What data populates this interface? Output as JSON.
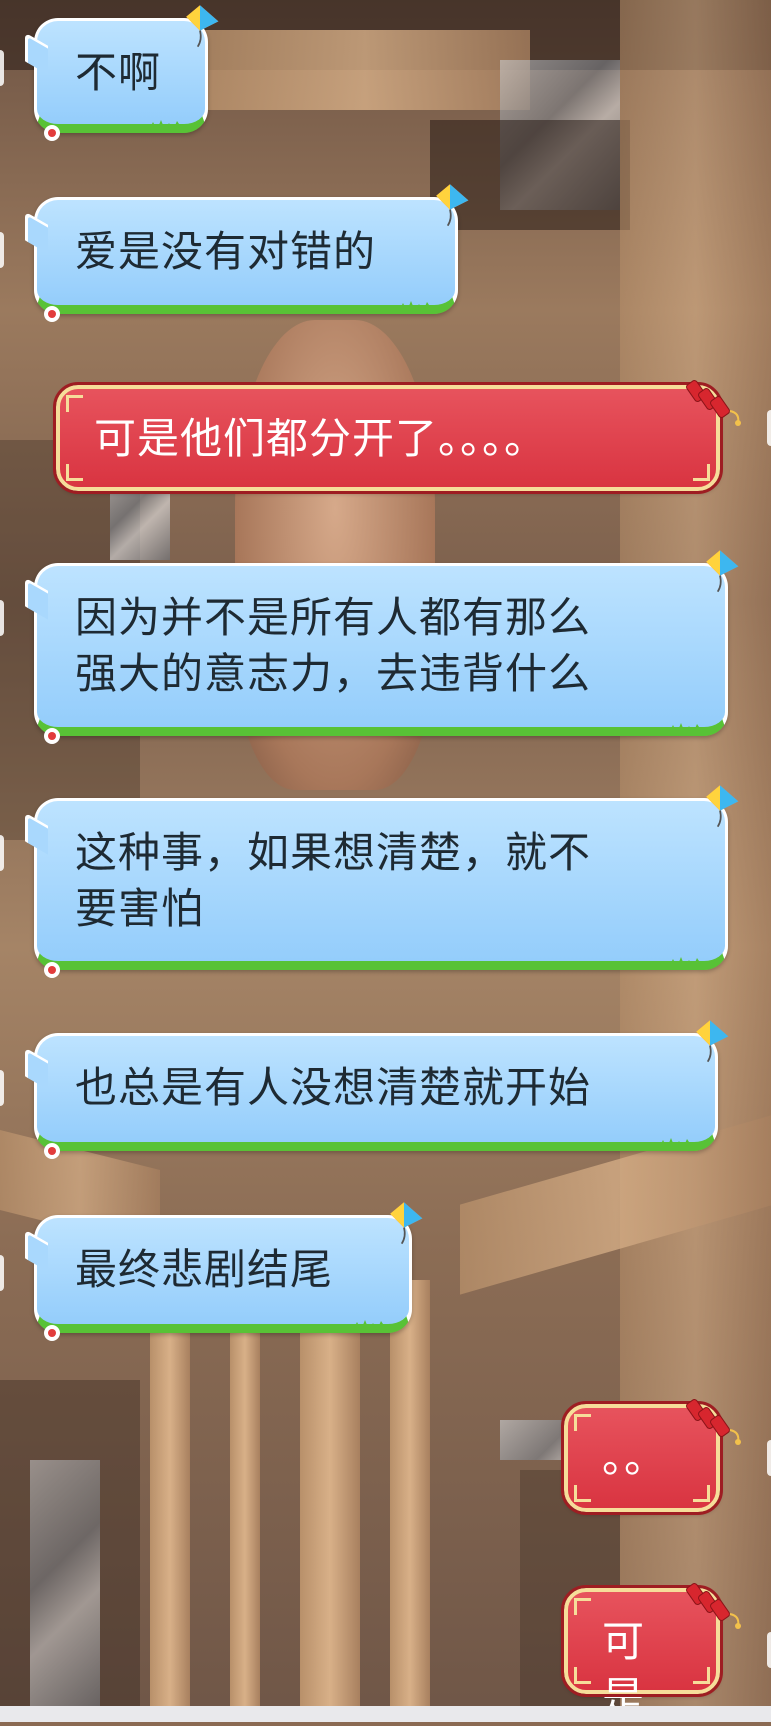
{
  "conversation": {
    "messages": [
      {
        "side": "left",
        "style": "blue",
        "text": "不啊"
      },
      {
        "side": "left",
        "style": "blue",
        "text": "爱是没有对错的"
      },
      {
        "side": "right",
        "style": "red",
        "text": "可是他们都分开了。。。。"
      },
      {
        "side": "left",
        "style": "blue",
        "text": "因为并不是所有人都有那么\n强大的意志力，去违背什么"
      },
      {
        "side": "left",
        "style": "blue",
        "text": "这种事，如果想清楚，就不\n要害怕"
      },
      {
        "side": "left",
        "style": "blue",
        "text": "也总是有人没想清楚就开始"
      },
      {
        "side": "left",
        "style": "blue",
        "text": "最终悲剧结尾"
      },
      {
        "side": "right",
        "style": "red",
        "text": "。。"
      },
      {
        "side": "right",
        "style": "red",
        "text": "可是"
      }
    ]
  },
  "icons": {
    "blue_bubble_decor": "kite-icon",
    "red_bubble_decor": "firecracker-icon"
  },
  "colors": {
    "blue_bubble": "#94cdfb",
    "blue_bubble_border": "#ffffff",
    "grass_strip": "#58c236",
    "red_bubble": "#d93441",
    "red_bubble_border": "#f6dd9a"
  }
}
